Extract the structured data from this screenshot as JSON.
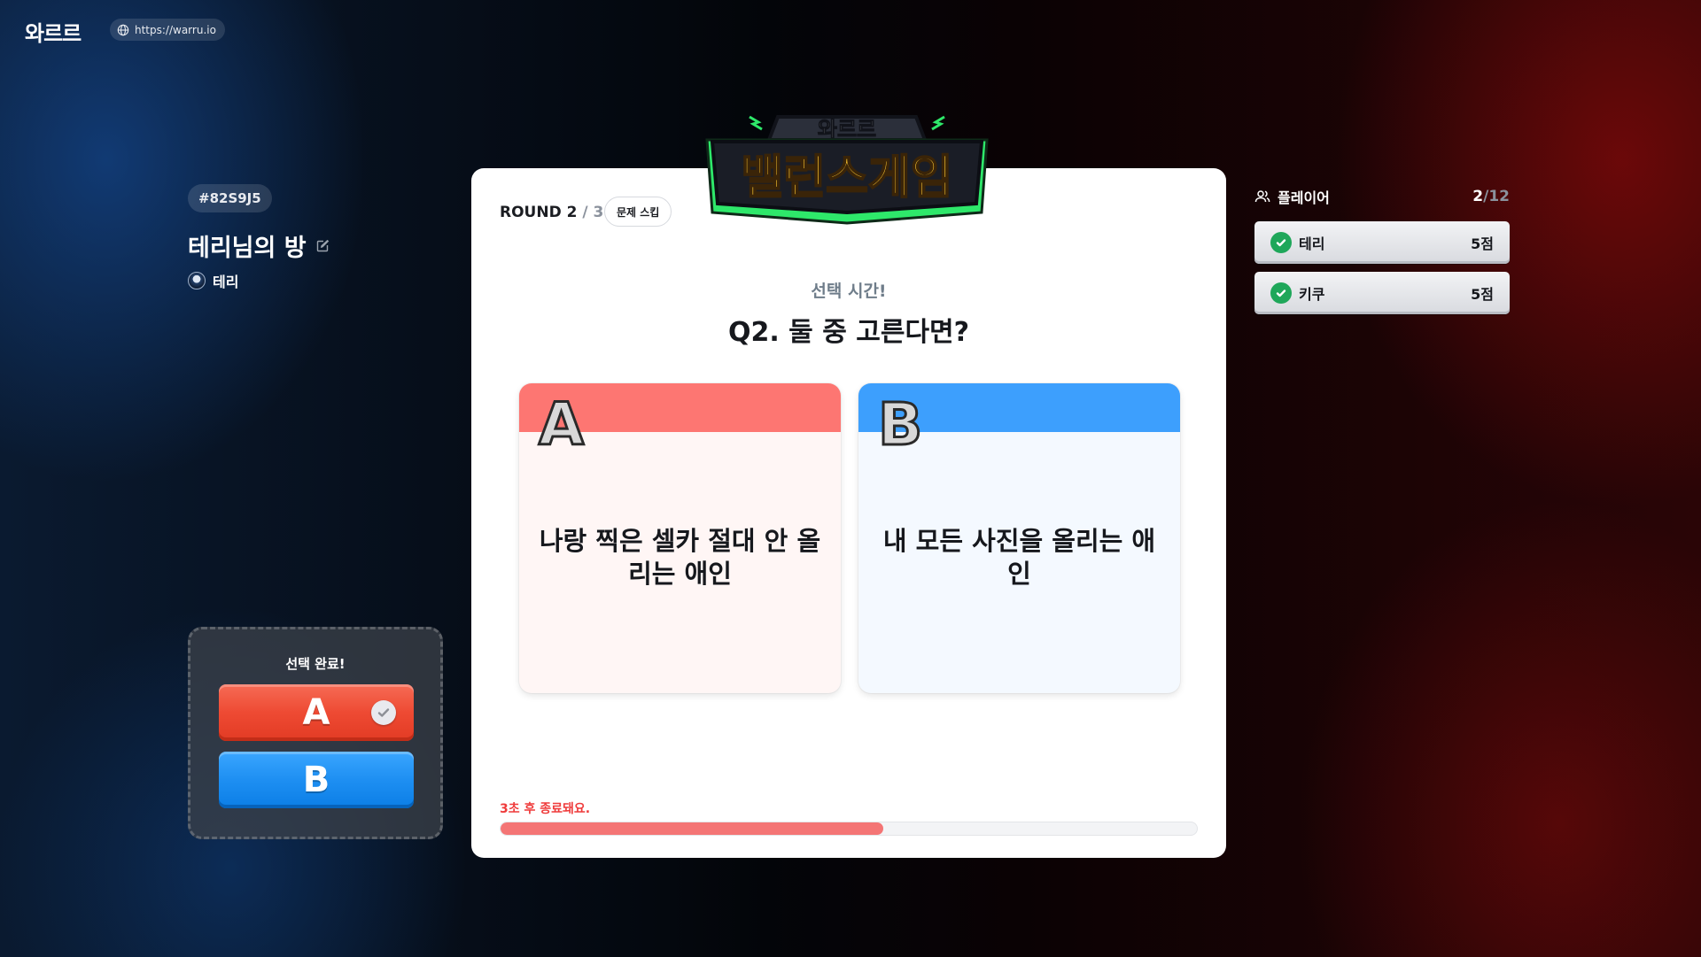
{
  "topbar": {
    "logo": "와르르",
    "url": "https://warru.io"
  },
  "room": {
    "code": "#82S9J5",
    "title": "테리님의 방",
    "host": "테리"
  },
  "my_choice": {
    "label": "선택 완료!",
    "option_a": "A",
    "option_b": "B",
    "selected": "A"
  },
  "game_title": {
    "line1": "와르르",
    "line2": "밸런스게임"
  },
  "game": {
    "round_label": "ROUND",
    "round_current": "2",
    "round_total": "/ 3",
    "skip_label": "문제 스킵",
    "phase": "선택 시간!",
    "question": "Q2. 둘 중 고른다면?",
    "option_a": {
      "letter": "A",
      "text": "나랑 찍은 셀카 절대 안 올리는 애인",
      "color": "#fd7672"
    },
    "option_b": {
      "letter": "B",
      "text": "내 모든 사진을 올리는 애인",
      "color": "#3d9ffd"
    },
    "timer_text": "3초 후 종료돼요.",
    "progress_fraction": 0.55
  },
  "players": {
    "label": "플레이어",
    "count": "2",
    "max": "/12",
    "list": [
      {
        "name": "테리",
        "score": "5점",
        "ready": true
      },
      {
        "name": "키쿠",
        "score": "5점",
        "ready": true
      }
    ]
  }
}
